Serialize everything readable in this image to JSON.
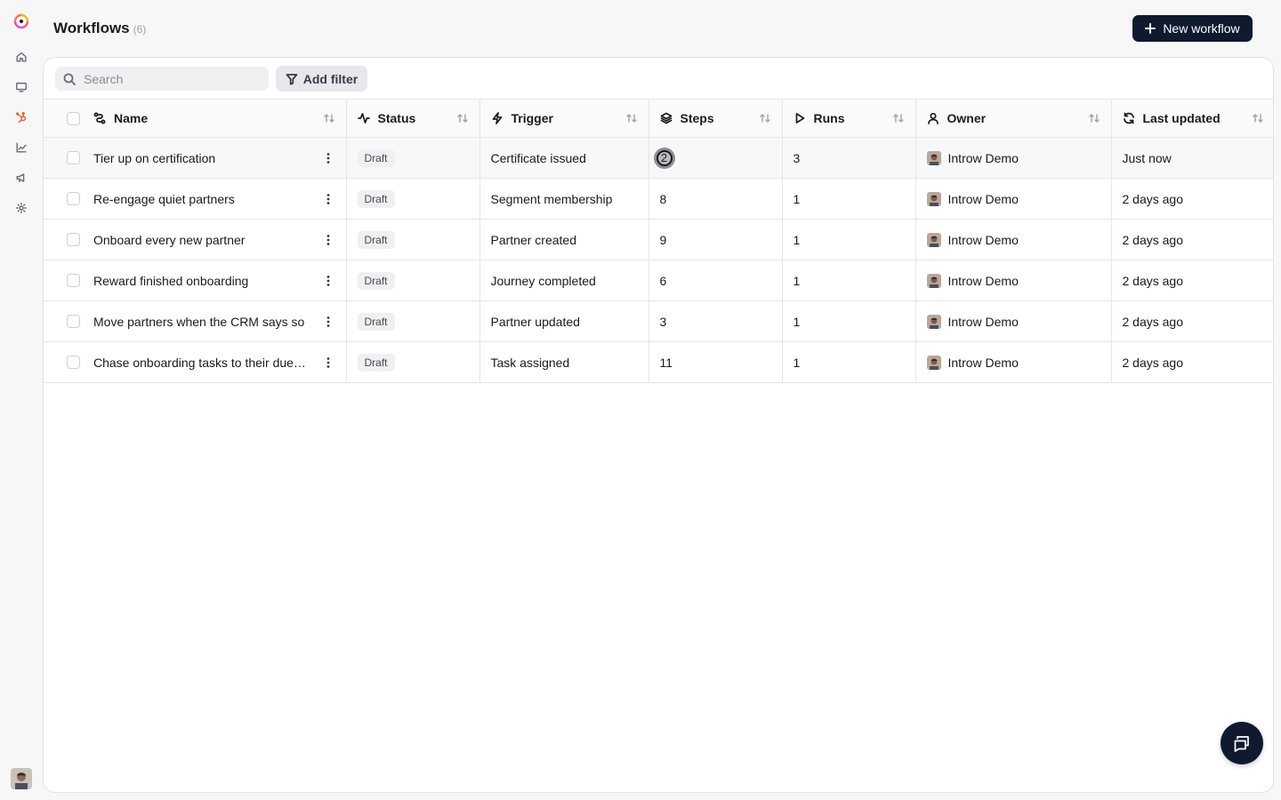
{
  "header": {
    "title": "Workflows",
    "count": "(6)",
    "new_button_label": "New workflow"
  },
  "sidebar": {
    "items": [
      {
        "name": "home-icon"
      },
      {
        "name": "monitor-icon"
      },
      {
        "name": "hubspot-icon",
        "active": true
      },
      {
        "name": "chart-icon"
      },
      {
        "name": "megaphone-icon"
      },
      {
        "name": "gear-icon"
      }
    ]
  },
  "toolbar": {
    "search_placeholder": "Search",
    "filter_label": "Add filter"
  },
  "table": {
    "columns": [
      "Name",
      "Status",
      "Trigger",
      "Steps",
      "Runs",
      "Owner",
      "Last updated"
    ],
    "rows": [
      {
        "name": "Tier up on certification",
        "status": "Draft",
        "trigger": "Certificate issued",
        "steps": "2",
        "runs": "3",
        "owner": "Introw Demo",
        "updated": "Just now"
      },
      {
        "name": "Re-engage quiet partners",
        "status": "Draft",
        "trigger": "Segment membership",
        "steps": "8",
        "runs": "1",
        "owner": "Introw Demo",
        "updated": "2 days ago"
      },
      {
        "name": "Onboard every new partner",
        "status": "Draft",
        "trigger": "Partner created",
        "steps": "9",
        "runs": "1",
        "owner": "Introw Demo",
        "updated": "2 days ago"
      },
      {
        "name": "Reward finished onboarding",
        "status": "Draft",
        "trigger": "Journey completed",
        "steps": "6",
        "runs": "1",
        "owner": "Introw Demo",
        "updated": "2 days ago"
      },
      {
        "name": "Move partners when the CRM says so",
        "status": "Draft",
        "trigger": "Partner updated",
        "steps": "3",
        "runs": "1",
        "owner": "Introw Demo",
        "updated": "2 days ago"
      },
      {
        "name": "Chase onboarding tasks to their due…",
        "status": "Draft",
        "trigger": "Task assigned",
        "steps": "11",
        "runs": "1",
        "owner": "Introw Demo",
        "updated": "2 days ago"
      }
    ]
  },
  "colors": {
    "primary": "#0f1a2e",
    "accent": "#f15a2b"
  }
}
